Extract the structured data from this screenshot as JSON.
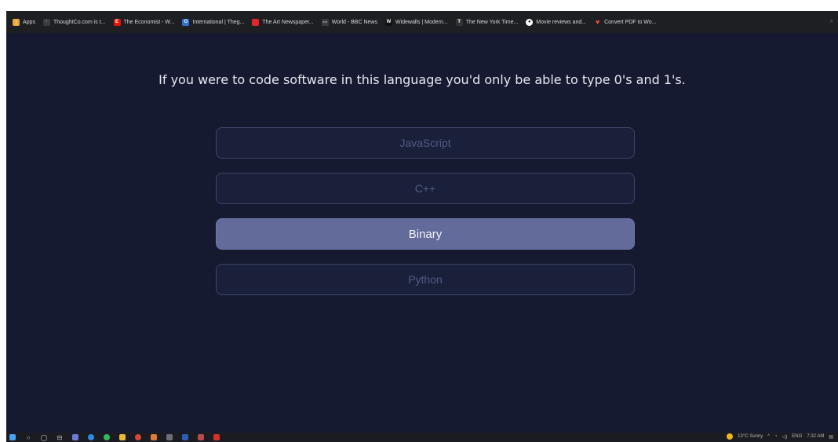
{
  "bookmarks": {
    "items": [
      {
        "label": "Apps",
        "icon": "apps-grid-icon",
        "color": "#e8a93a",
        "glyph": "⋮⋮"
      },
      {
        "label": "ThoughtCo.com is t...",
        "icon": "thoughtco-icon",
        "color": "#3a3b40",
        "glyph": "·"
      },
      {
        "label": "The Economist - W...",
        "icon": "economist-icon",
        "color": "#e3120b",
        "glyph": "E"
      },
      {
        "label": "International | Theg...",
        "icon": "guardian-icon",
        "color": "#2f6fd6",
        "glyph": "G"
      },
      {
        "label": "The Art Newspaper...",
        "icon": "art-newspaper-icon",
        "color": "#e0262b",
        "glyph": ""
      },
      {
        "label": "World - BBC News",
        "icon": "bbc-icon",
        "color": "#3a3b40",
        "glyph": "⋯"
      },
      {
        "label": "Widewalls | Modern...",
        "icon": "widewalls-icon",
        "color": "#111111",
        "glyph": "W"
      },
      {
        "label": "The New York Time...",
        "icon": "nytimes-icon",
        "color": "#333333",
        "glyph": "T"
      },
      {
        "label": "Movie reviews and...",
        "icon": "movie-reviews-icon",
        "color": "#ffffff",
        "glyph": "●"
      },
      {
        "label": "Convert PDF to Wo...",
        "icon": "pdf-convert-icon",
        "color": "#e8503a",
        "glyph": "♥"
      }
    ],
    "overflow_glyph": "»"
  },
  "quiz": {
    "question": "If you were to code software in this language you'd only be able to type 0's and 1's.",
    "answers": [
      {
        "label": "JavaScript",
        "selected": false
      },
      {
        "label": "C++",
        "selected": false
      },
      {
        "label": "Binary",
        "selected": true
      },
      {
        "label": "Python",
        "selected": false
      }
    ]
  },
  "taskbar": {
    "weather": "13°C Sunny",
    "language": "ENG",
    "time": "7:32 AM"
  },
  "colors": {
    "background": "#151a31",
    "answer_border": "#3e4567",
    "answer_text": "#525b85",
    "selected_fill": "#626b9a",
    "question_text": "#e6e8f0"
  }
}
